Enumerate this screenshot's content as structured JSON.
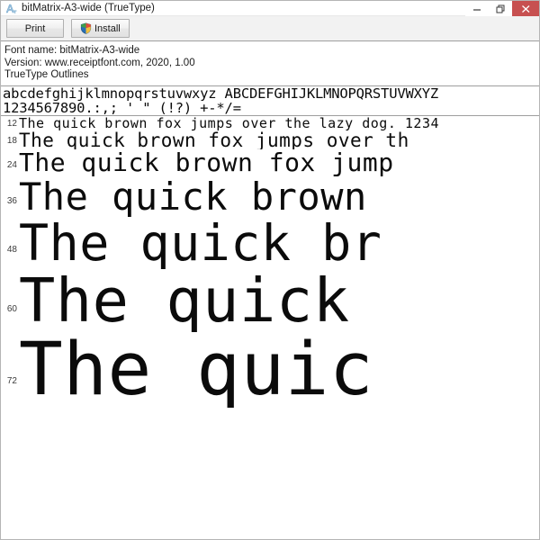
{
  "window": {
    "title": "bitMatrix-A3-wide (TrueType)",
    "icon": "font-a-icon",
    "controls": {
      "minimize": "minimize-icon",
      "maximize": "restore-icon",
      "close": "close-icon"
    },
    "accent_close_color": "#c75050"
  },
  "toolbar": {
    "print_label": "Print",
    "install_label": "Install",
    "install_icon": "uac-shield-icon"
  },
  "info": {
    "font_name_line": "Font name: bitMatrix-A3-wide",
    "version_line": "Version: www.receiptfont.com, 2020, 1.00",
    "outlines_line": "TrueType Outlines"
  },
  "charset": {
    "line1": "abcdefghijklmnopqrstuvwxyz ABCDEFGHIJKLMNOPQRSTUVWXYZ",
    "line2": "1234567890.:,; ' \" (!?) +-*/="
  },
  "samples": [
    {
      "size": "12",
      "text": "The quick brown fox jumps over the lazy dog. 1234"
    },
    {
      "size": "18",
      "text": "The quick brown fox jumps over th"
    },
    {
      "size": "24",
      "text": "The quick brown fox jump"
    },
    {
      "size": "36",
      "text": "The quick brown"
    },
    {
      "size": "48",
      "text": "The quick br"
    },
    {
      "size": "60",
      "text": "The quick"
    },
    {
      "size": "72",
      "text": "The quic"
    }
  ]
}
